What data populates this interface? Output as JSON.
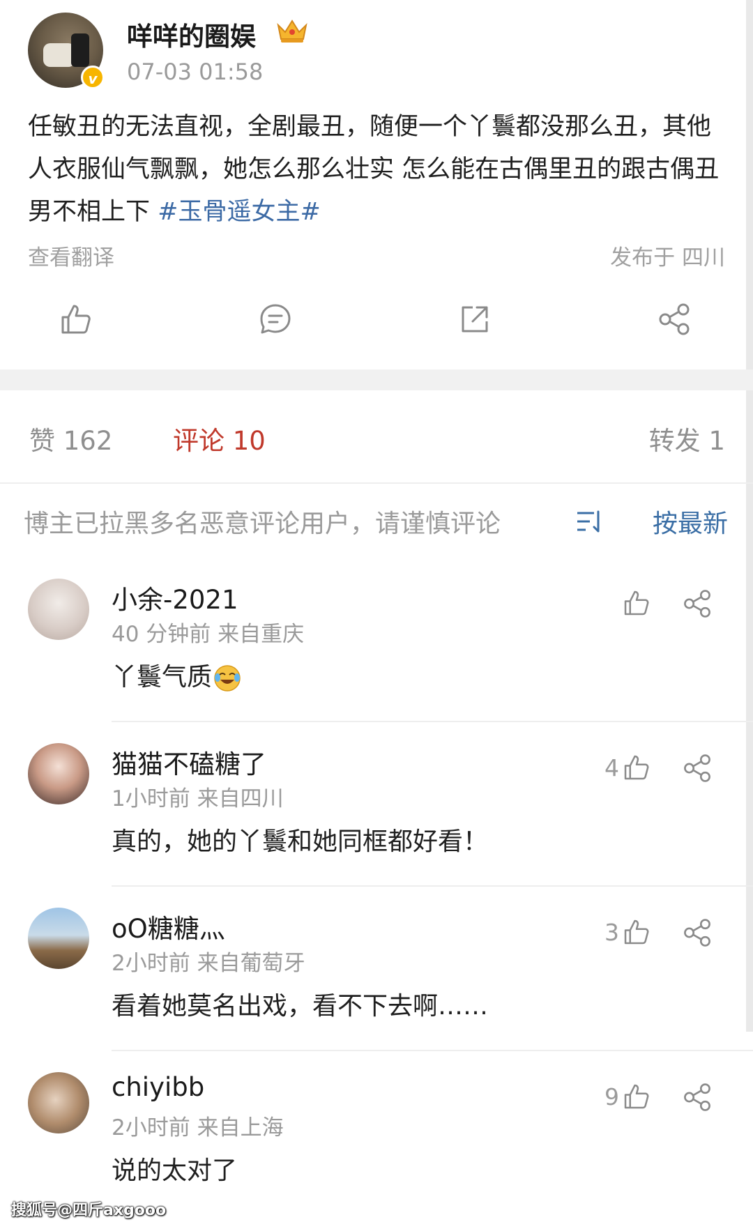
{
  "post": {
    "username": "咩咩的圈娱",
    "time": "07-03 01:58",
    "text": "任敏丑的无法直视，全剧最丑，随便一个丫鬟都没那么丑，其他人衣服仙气飘飘，她怎么那么壮实 怎么能在古偶里丑的跟古偶丑男不相上下 ",
    "hashtag": "#玉骨遥女主#",
    "translate": "查看翻译",
    "location": "发布于 四川",
    "verified_badge": "v"
  },
  "actions": {
    "like_icon": "thumbs-up-icon",
    "comment_icon": "comment-icon",
    "repost_icon": "repost-icon",
    "share_icon": "share-icon"
  },
  "stats": {
    "like_label": "赞  162",
    "comment_label": "评论  10",
    "repost_label": "转发  1"
  },
  "notice": "博主已拉黑多名恶意评论用户，请谨慎评论",
  "sort_label": "按最新",
  "comments": [
    {
      "name": "小余-2021",
      "meta": "40 分钟前   来自重庆",
      "text": "丫鬟气质",
      "likes": "",
      "emoji": "laugh-cry-emoji"
    },
    {
      "name": "猫猫不磕糖了",
      "meta": "1小时前   来自四川",
      "text": "真的，她的丫鬟和她同框都好看！",
      "likes": "4"
    },
    {
      "name": "oO糖糖灬",
      "meta": "2小时前   来自葡萄牙",
      "text": "看着她莫名出戏，看不下去啊……",
      "likes": "3"
    },
    {
      "name": "chiyibb",
      "meta": "2小时前   来自上海",
      "text": "说的太对了",
      "likes": "9"
    }
  ],
  "watermark": "搜狐号@四斤axgooo",
  "colors": {
    "accent_red": "#c0392b",
    "link_blue": "#3c6aa5",
    "muted_gray": "#9a9a9a"
  }
}
